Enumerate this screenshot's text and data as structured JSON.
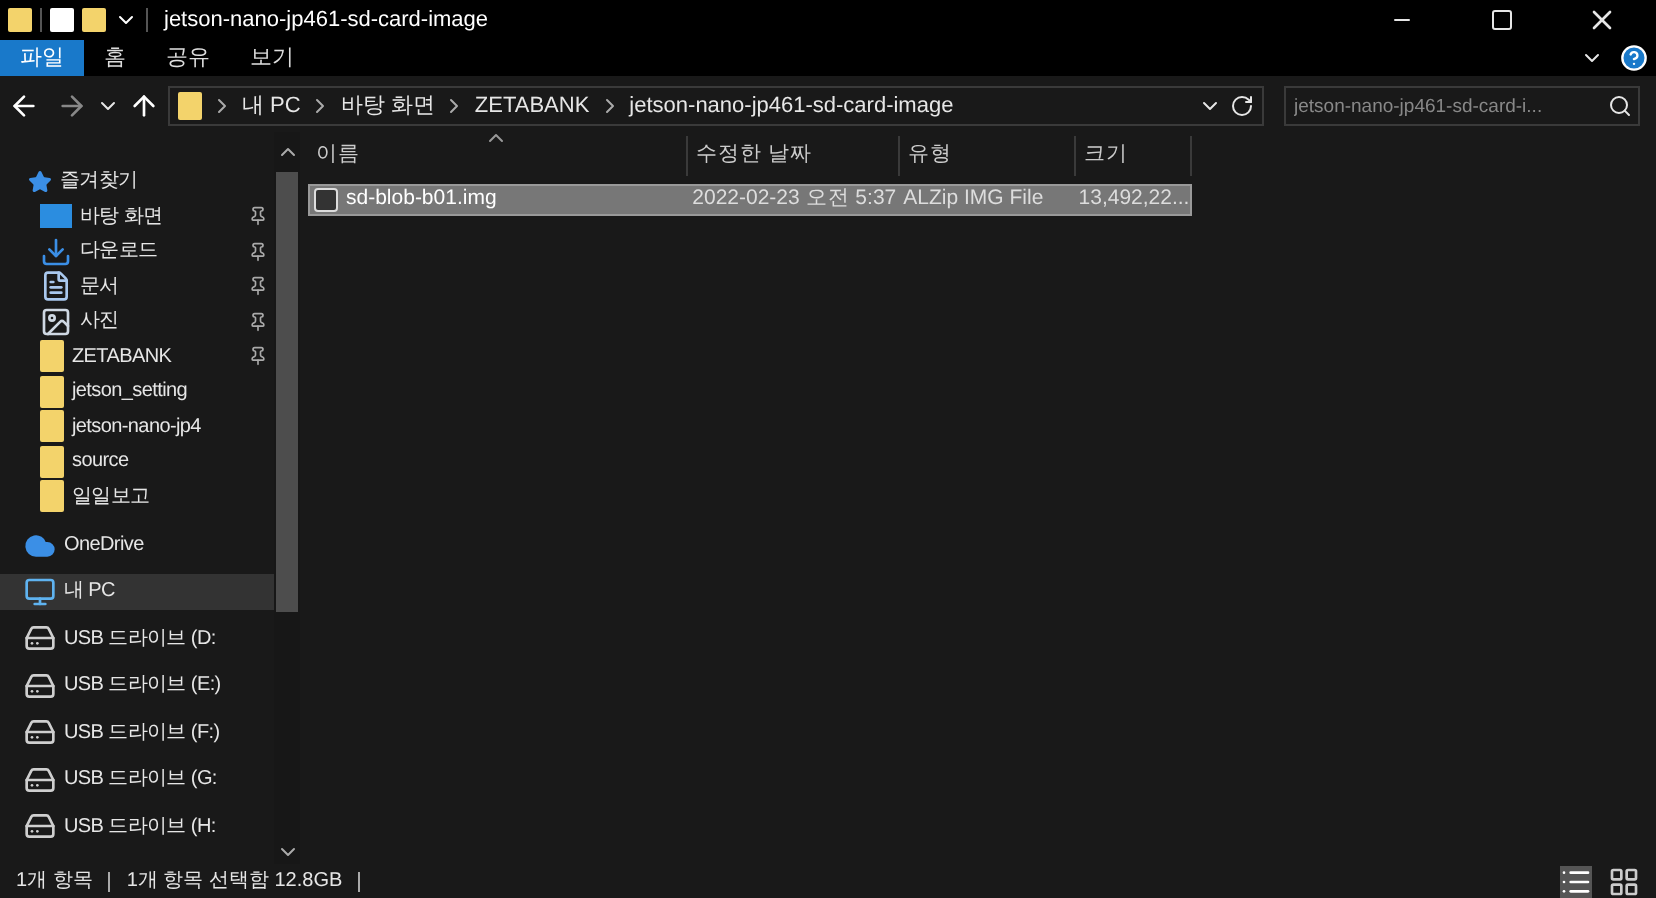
{
  "window": {
    "title": "jetson-nano-jp461-sd-card-image"
  },
  "ribbon_tabs": [
    {
      "label": "파일",
      "selected": true
    },
    {
      "label": "홈",
      "selected": false
    },
    {
      "label": "공유",
      "selected": false
    },
    {
      "label": "보기",
      "selected": false
    }
  ],
  "breadcrumb": [
    "내 PC",
    "바탕 화면",
    "ZETABANK",
    "jetson-nano-jp461-sd-card-image"
  ],
  "search": {
    "placeholder": "jetson-nano-jp461-sd-card-i..."
  },
  "sidebar": {
    "items": [
      {
        "kind": "star",
        "label": "즐겨찾기",
        "pinned": false,
        "selected": false
      },
      {
        "kind": "desktop",
        "label": "바탕 화면",
        "pinned": true,
        "selected": false
      },
      {
        "kind": "download",
        "label": "다운로드",
        "pinned": true,
        "selected": false
      },
      {
        "kind": "document",
        "label": "문서",
        "pinned": true,
        "selected": false
      },
      {
        "kind": "picture",
        "label": "사진",
        "pinned": true,
        "selected": false
      },
      {
        "kind": "folder",
        "label": "ZETABANK",
        "pinned": true,
        "selected": false
      },
      {
        "kind": "folder",
        "label": "jetson_setting",
        "pinned": false,
        "selected": false
      },
      {
        "kind": "folder",
        "label": "jetson-nano-jp4",
        "pinned": false,
        "selected": false
      },
      {
        "kind": "folder",
        "label": "source",
        "pinned": false,
        "selected": false
      },
      {
        "kind": "folder",
        "label": "일일보고",
        "pinned": false,
        "selected": false
      },
      {
        "kind": "cloud",
        "label": "OneDrive",
        "pinned": false,
        "selected": false
      },
      {
        "kind": "pc",
        "label": "내 PC",
        "pinned": false,
        "selected": true
      },
      {
        "kind": "drive",
        "label": "USB 드라이브 (D:",
        "pinned": false,
        "selected": false
      },
      {
        "kind": "drive",
        "label": "USB 드라이브 (E:)",
        "pinned": false,
        "selected": false
      },
      {
        "kind": "drive",
        "label": "USB 드라이브 (F:)",
        "pinned": false,
        "selected": false
      },
      {
        "kind": "drive",
        "label": "USB 드라이브 (G:",
        "pinned": false,
        "selected": false
      },
      {
        "kind": "drive",
        "label": "USB 드라이브 (H:",
        "pinned": false,
        "selected": false
      }
    ]
  },
  "table": {
    "columns": [
      "이름",
      "수정한 날짜",
      "유형",
      "크기"
    ],
    "rows": [
      {
        "cells": [
          "sd-blob-b01.img",
          "2022-02-23 오전 5:37",
          "ALZip IMG File",
          "13,492,22..."
        ],
        "selected": true
      }
    ]
  },
  "status_bar": [
    "1개 항목",
    "1개 항목 선택함 12.8GB"
  ]
}
